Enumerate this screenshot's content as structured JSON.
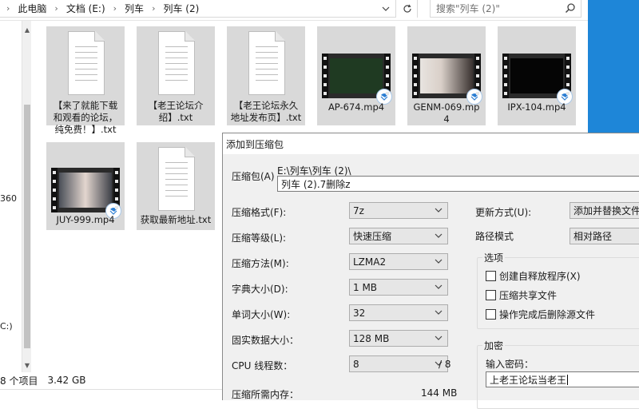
{
  "explorer": {
    "breadcrumb": [
      "此电脑",
      "文档 (E:)",
      "列车",
      "列车 (2)"
    ],
    "search_placeholder": "搜索\"列车 (2)\"",
    "nav_labels": [
      "360",
      "C:)"
    ],
    "status": {
      "item_count": "8 个项目",
      "size": "3.42 GB"
    },
    "files": [
      {
        "name": "【来了就能下载和观看的论坛，纯免费！】.txt",
        "kind": "txt"
      },
      {
        "name": "【老王论坛介绍】.txt",
        "kind": "txt"
      },
      {
        "name": "【老王论坛永久地址发布页】.txt",
        "kind": "txt"
      },
      {
        "name": "AP-674.mp4",
        "kind": "video"
      },
      {
        "name": "GENM-069.mp4",
        "kind": "video"
      },
      {
        "name": "IPX-104.mp4",
        "kind": "video"
      },
      {
        "name": "JUY-999.mp4",
        "kind": "video"
      },
      {
        "name": "获取最新地址.txt",
        "kind": "txt"
      }
    ],
    "colors": {
      "tile_bg": "#d9d9d9",
      "accent": "#1e86d8"
    }
  },
  "dialog": {
    "title": "添加到压缩包",
    "archive_label": "压缩包(A)",
    "archive_path": "E:\\列车\\列车 (2)\\",
    "archive_name": "列车 (2).7删除z",
    "fields": [
      {
        "label": "压缩格式(F):",
        "value": "7z"
      },
      {
        "label": "压缩等级(L):",
        "value": "快速压缩"
      },
      {
        "label": "压缩方法(M):",
        "value": "LZMA2"
      },
      {
        "label": "字典大小(D):",
        "value": "1 MB"
      },
      {
        "label": "单词大小(W):",
        "value": "32"
      },
      {
        "label": "固实数据大小：",
        "value": "128 MB"
      },
      {
        "label": "CPU 线程数：",
        "value": "8"
      }
    ],
    "threads_max": "/ 8",
    "memory_label": "压缩所需内存：",
    "memory_value": "144 MB",
    "update_mode_label": "更新方式(U):",
    "update_mode_value": "添加并替换文件",
    "path_mode_label": "路径模式",
    "path_mode_value": "相对路径",
    "options_legend": "选项",
    "options": [
      {
        "label": "创建自释放程序(X)",
        "checked": false
      },
      {
        "label": "压缩共享文件",
        "checked": false
      },
      {
        "label": "操作完成后删除源文件",
        "checked": false
      }
    ],
    "encryption_legend": "加密",
    "password_label": "输入密码：",
    "password_value": "上老王论坛当老王"
  }
}
